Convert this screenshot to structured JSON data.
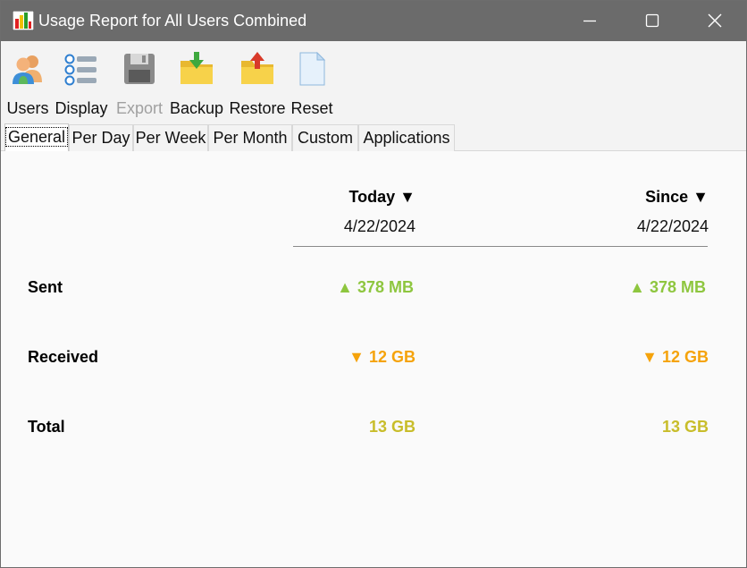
{
  "window": {
    "title": "Usage Report for All Users Combined",
    "icon": "bar-chart-app-icon",
    "controls": [
      "minimize-icon",
      "maximize-icon",
      "close-icon"
    ]
  },
  "toolbar": {
    "users_label": "Users",
    "display_label": "Display",
    "export_label": "Export",
    "backup_label": "Backup",
    "restore_label": "Restore",
    "reset_label": "Reset"
  },
  "tabs": [
    {
      "label": "General",
      "active": true
    },
    {
      "label": "Per Day"
    },
    {
      "label": "Per Week"
    },
    {
      "label": "Per Month"
    },
    {
      "label": "Custom"
    },
    {
      "label": "Applications"
    }
  ],
  "report": {
    "columns": [
      {
        "header": "Today ▼",
        "date": "4/22/2024"
      },
      {
        "header": "Since ▼",
        "date": "4/22/2024"
      }
    ],
    "rows": {
      "sent": {
        "label": "Sent",
        "today": "▲ 378 MB",
        "since": "▲ 378 MB"
      },
      "received": {
        "label": "Received",
        "today": "▼ 12 GB",
        "since": "▼ 12 GB"
      },
      "total": {
        "label": "Total",
        "today": "13 GB",
        "since": "13 GB"
      }
    }
  },
  "colors": {
    "titlebar": "#6b6b6b",
    "sent": "#8ec63f",
    "received": "#f5a30b",
    "total": "#c8bd2a"
  }
}
